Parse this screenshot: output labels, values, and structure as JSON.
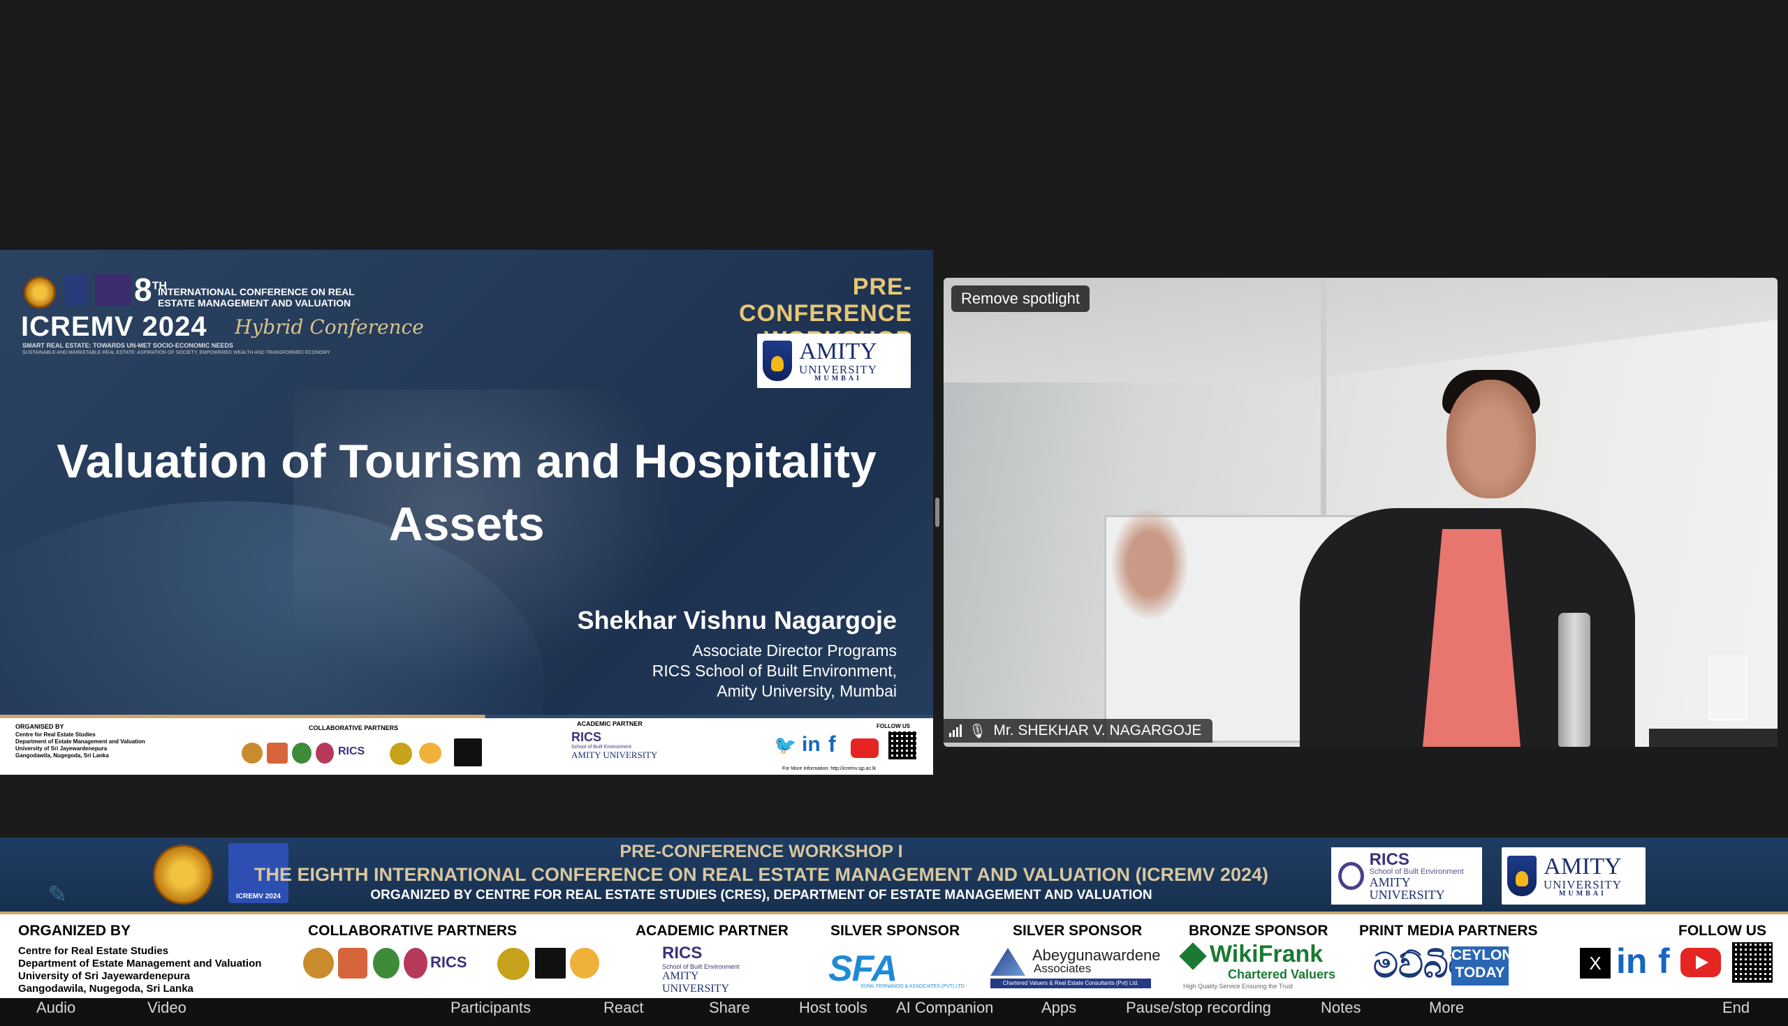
{
  "slide": {
    "conference_number": "8",
    "conference_ordinal": "TH",
    "conference_line": "INTERNATIONAL CONFERENCE ON REAL ESTATE MANAGEMENT AND VALUATION",
    "conference_name": "ICREMV 2024",
    "conference_mode": "Hybrid Conference",
    "tagline1": "SMART REAL ESTATE: TOWARDS UN-MET SOCIO-ECONOMIC NEEDS",
    "tagline2": "SUSTAINABLE AND MARKETABLE REAL ESTATE: ASPIRATION OF SOCIETY, EMPOWERED WEALTH AND TRANSFORMED ECONOMY",
    "workshop_line1": "PRE-CONFERENCE",
    "workshop_line2": "WORKSHOP",
    "amity_name": "AMITY",
    "amity_university": "UNIVERSITY",
    "amity_city": "MUMBAI",
    "title_line1": "Valuation of  Tourism and Hospitality",
    "title_line2": "Assets",
    "speaker_name": "Shekhar Vishnu Nagargoje",
    "speaker_role": "Associate Director Programs",
    "speaker_school": "RICS School of Built Environment,",
    "speaker_university": "Amity University, Mumbai",
    "footer": {
      "organised_by": "ORGANISED BY",
      "org_lines": [
        "Centre for Real Estate Studies",
        "Department of Estate Management and Valuation",
        "University of Sri Jayewardenepura",
        "Gangodawila, Nugegoda, Sri Lanka"
      ],
      "collaborative": "COLLABORATIVE PARTNERS",
      "rics": "RICS",
      "academic": "ACADEMIC PARTNER",
      "rics_school": "School of Built Environment",
      "amity_university": "AMITY UNIVERSITY",
      "follow": "FOLLOW US",
      "info": "For More Information: http://icremv.sjp.ac.lk"
    }
  },
  "video": {
    "spotlight_button": "Remove spotlight",
    "participant_name": "Mr. SHEKHAR V. NAGARGOJE"
  },
  "banner": {
    "line1": "PRE-CONFERENCE WORKSHOP I",
    "line2": "THE EIGHTH INTERNATIONAL CONFERENCE ON REAL ESTATE MANAGEMENT AND VALUATION (ICREMV 2024)",
    "line3": "ORGANIZED BY CENTRE FOR REAL ESTATE STUDIES (CRES), DEPARTMENT OF ESTATE MANAGEMENT AND VALUATION",
    "icremv_badge": "ICREMV 2024",
    "rics": "RICS",
    "rics_school": "School of Built Environment",
    "amity_university": "AMITY UNIVERSITY",
    "amity_name": "AMITY",
    "amity_uni": "UNIVERSITY",
    "amity_city": "MUMBAI"
  },
  "sponsors": {
    "organized_by": "ORGANIZED BY",
    "org_lines": [
      "Centre for Real Estate Studies",
      "Department of Estate Management and Valuation",
      "University of Sri Jayewardenepura",
      "Gangodawila, Nugegoda, Sri Lanka"
    ],
    "collaborative": "COLLABORATIVE PARTNERS",
    "collab_rics": "RICS",
    "academic": "ACADEMIC PARTNER",
    "academic_rics": "RICS",
    "academic_school": "School of Built Environment",
    "academic_amity": "AMITY UNIVERSITY",
    "silver1": "SILVER SPONSOR",
    "sfa": "SFA",
    "sfa_sub": "SUNIL FERNANDO & ASSOCIATES (PVT) LTD",
    "silver2": "SILVER SPONSOR",
    "abey_name": "Abeygunawardene",
    "abey_assoc": "Associates",
    "abey_sub": "Chartered Valuers & Real Estate Consultants (Pvt) Ltd.",
    "bronze": "BRONZE SPONSOR",
    "wiki_name": "WikiFrank",
    "wiki_sub": "Chartered Valuers",
    "wiki_tag": "High Quality Service Ensuring the Trust",
    "print_media": "PRINT MEDIA PARTNERS",
    "print_si": "මව්බිම",
    "ceylon_line1": "CEYLON",
    "ceylon_line2": "TODAY",
    "follow": "FOLLOW US",
    "x_icon": "X",
    "in_icon": "in",
    "f_icon": "f"
  },
  "toolbar": {
    "items": [
      "Audio",
      "Video",
      "Participants",
      "React",
      "Share",
      "Host tools",
      "AI Companion",
      "Apps",
      "Pause/stop recording",
      "Notes",
      "More",
      "End"
    ]
  }
}
